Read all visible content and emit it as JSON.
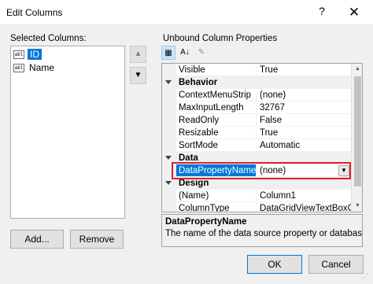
{
  "window": {
    "title": "Edit Columns",
    "help_glyph": "?",
    "close_glyph": "✕"
  },
  "left_panel": {
    "label": "Selected Columns:",
    "items": [
      {
        "icon": "abl",
        "label": "ID",
        "selected": true
      },
      {
        "icon": "abl",
        "label": "Name",
        "selected": false
      }
    ],
    "move_up_glyph": "▲",
    "move_down_glyph": "▼",
    "add_button": "Add...",
    "remove_button": "Remove"
  },
  "right_panel": {
    "label": "Unbound Column Properties",
    "toolbar": {
      "categorized_glyph": "▦",
      "alphabetical_glyph": "A↓",
      "properties_glyph": "✎"
    },
    "grid": {
      "rows": [
        {
          "type": "prop",
          "name": "Visible",
          "value": "True"
        },
        {
          "type": "cat",
          "name": "Behavior"
        },
        {
          "type": "prop",
          "name": "ContextMenuStrip",
          "value": "(none)"
        },
        {
          "type": "prop",
          "name": "MaxInputLength",
          "value": "32767"
        },
        {
          "type": "prop",
          "name": "ReadOnly",
          "value": "False"
        },
        {
          "type": "prop",
          "name": "Resizable",
          "value": "True"
        },
        {
          "type": "prop",
          "name": "SortMode",
          "value": "Automatic"
        },
        {
          "type": "cat",
          "name": "Data"
        },
        {
          "type": "prop",
          "name": "DataPropertyName",
          "value": "(none)",
          "selected": true,
          "dropdown": true
        },
        {
          "type": "cat",
          "name": "Design"
        },
        {
          "type": "prop",
          "name": "(Name)",
          "value": "Column1"
        },
        {
          "type": "prop",
          "name": "ColumnType",
          "value": "DataGridViewTextBoxCol"
        }
      ]
    },
    "description": {
      "title": "DataPropertyName",
      "text": "The name of the data source property or database"
    }
  },
  "footer": {
    "ok_button": "OK",
    "cancel_button": "Cancel"
  },
  "colors": {
    "selection": "#0078d7",
    "highlight_box": "#e0202a",
    "background": "#f0f0f0"
  }
}
